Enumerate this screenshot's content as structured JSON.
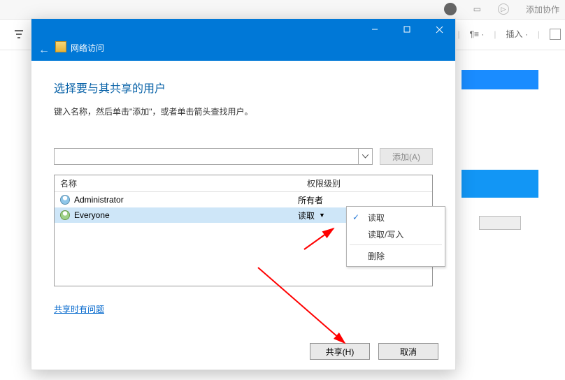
{
  "background": {
    "top_action": "添加协作",
    "toolbar_insert": "插入"
  },
  "dialog": {
    "title": "网络访问",
    "heading": "选择要与其共享的用户",
    "instruction": "键入名称，然后单击\"添加\"，或者单击箭头查找用户。",
    "add_button": "添加(A)",
    "combo_value": "",
    "columns": {
      "name": "名称",
      "permission": "权限级别"
    },
    "rows": [
      {
        "name": "Administrator",
        "permission": "所有者",
        "selected": false,
        "icon": "blue"
      },
      {
        "name": "Everyone",
        "permission": "读取",
        "selected": true,
        "icon": "green",
        "dropdown": true
      }
    ],
    "menu": {
      "read": "读取",
      "readwrite": "读取/写入",
      "delete": "删除",
      "checked": "read"
    },
    "help_link": "共享时有问题",
    "share_button": "共享(H)",
    "cancel_button": "取消"
  }
}
